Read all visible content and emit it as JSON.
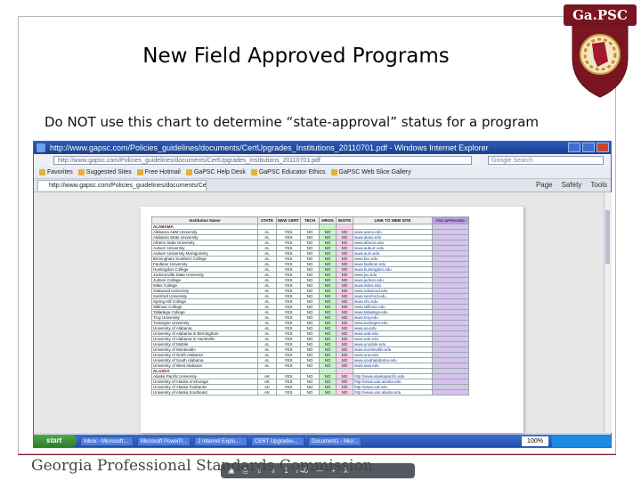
{
  "slide": {
    "title": "New Field Approved Programs",
    "subtitle": "Do NOT use this chart to determine “state-approval” status for a program",
    "footer": "Georgia Professional Standards Commission",
    "logo": {
      "banner": "Ga.PSC",
      "icon": "gapsc-shield-seal-icon"
    }
  },
  "screenshot": {
    "window_title": "http://www.gapsc.com/Policies_guidelines/documents/CertUpgrades_Institutions_20110701.pdf - Windows Internet Explorer",
    "address": "http://www.gapsc.com/Policies_guidelines/documents/CertUpgrades_Institutions_20110701.pdf",
    "search_placeholder": "Google Search",
    "favorites": [
      {
        "label": "Favorites"
      },
      {
        "label": "Suggested Sites"
      },
      {
        "label": "Free Hotmail"
      },
      {
        "label": "GaPSC Help Desk"
      },
      {
        "label": "GaPSC Educator Ethics"
      },
      {
        "label": "GaPSC Web Slice Gallery"
      }
    ],
    "tab_label": "http://www.gapsc.com/Policies_guidelines/documents/Cer...",
    "tab_tools": [
      "Page",
      "Safety",
      "Tools"
    ],
    "table": {
      "headers": [
        "Institution Name",
        "STATE",
        "NEW CERT",
        "TECH",
        "HRGN",
        "INSITE",
        "LINK TO WEB SITE",
        "PSC APPROVED"
      ],
      "rows": [
        {
          "name": "ALABAMA",
          "state_header": true
        },
        {
          "name": "Alabama A&M University",
          "st": "AL",
          "a": "YES",
          "b": "NO",
          "c": "NO",
          "d": "NO",
          "link": "www.aamu.edu"
        },
        {
          "name": "Alabama State University",
          "st": "AL",
          "a": "YES",
          "b": "NO",
          "c": "NO",
          "d": "NO",
          "link": "www.alasu.edu"
        },
        {
          "name": "Athens State University",
          "st": "AL",
          "a": "YES",
          "b": "NO",
          "c": "NO",
          "d": "NO",
          "link": "www.athens.edu"
        },
        {
          "name": "Auburn University",
          "st": "AL",
          "a": "YES",
          "b": "NO",
          "c": "NO",
          "d": "NO",
          "link": "www.auburn.edu"
        },
        {
          "name": "Auburn University Montgomery",
          "st": "AL",
          "a": "YES",
          "b": "NO",
          "c": "NO",
          "d": "NO",
          "link": "www.aum.edu"
        },
        {
          "name": "Birmingham Southern College",
          "st": "AL",
          "a": "YES",
          "b": "NO",
          "c": "NO",
          "d": "NO",
          "link": "www.bsc.edu"
        },
        {
          "name": "Faulkner University",
          "st": "AL",
          "a": "YES",
          "b": "NO",
          "c": "NO",
          "d": "NO",
          "link": "www.faulkner.edu"
        },
        {
          "name": "Huntingdon College",
          "st": "AL",
          "a": "YES",
          "b": "NO",
          "c": "NO",
          "d": "NO",
          "link": "www.huntingdon.edu"
        },
        {
          "name": "Jacksonville State University",
          "st": "AL",
          "a": "YES",
          "b": "NO",
          "c": "NO",
          "d": "NO",
          "link": "www.jsu.edu"
        },
        {
          "name": "Judson College",
          "st": "AL",
          "a": "YES",
          "b": "NO",
          "c": "NO",
          "d": "NO",
          "link": "www.judson.edu"
        },
        {
          "name": "Miles College",
          "st": "AL",
          "a": "YES",
          "b": "NO",
          "c": "NO",
          "d": "NO",
          "link": "www.miles.edu"
        },
        {
          "name": "Oakwood University",
          "st": "AL",
          "a": "YES",
          "b": "NO",
          "c": "NO",
          "d": "NO",
          "link": "www.oakwood.edu"
        },
        {
          "name": "Samford University",
          "st": "AL",
          "a": "YES",
          "b": "NO",
          "c": "NO",
          "d": "NO",
          "link": "www.samford.edu"
        },
        {
          "name": "Spring Hill College",
          "st": "AL",
          "a": "YES",
          "b": "NO",
          "c": "NO",
          "d": "NO",
          "link": "www.shc.edu"
        },
        {
          "name": "Stillman College",
          "st": "AL",
          "a": "YES",
          "b": "NO",
          "c": "NO",
          "d": "NO",
          "link": "www.stillman.edu"
        },
        {
          "name": "Talladega College",
          "st": "AL",
          "a": "YES",
          "b": "NO",
          "c": "NO",
          "d": "NO",
          "link": "www.talladega.edu"
        },
        {
          "name": "Troy University",
          "st": "AL",
          "a": "YES",
          "b": "NO",
          "c": "NO",
          "d": "NO",
          "link": "www.troy.edu"
        },
        {
          "name": "Tuskegee University",
          "st": "AL",
          "a": "YES",
          "b": "NO",
          "c": "NO",
          "d": "NO",
          "link": "www.tuskegee.edu"
        },
        {
          "name": "University of Alabama",
          "st": "AL",
          "a": "YES",
          "b": "NO",
          "c": "NO",
          "d": "NO",
          "link": "www.ua.edu"
        },
        {
          "name": "University of Alabama in Birmingham",
          "st": "AL",
          "a": "YES",
          "b": "NO",
          "c": "NO",
          "d": "NO",
          "link": "www.uab.edu"
        },
        {
          "name": "University of Alabama in Huntsville",
          "st": "AL",
          "a": "YES",
          "b": "NO",
          "c": "NO",
          "d": "NO",
          "link": "www.uah.edu"
        },
        {
          "name": "University of Mobile",
          "st": "AL",
          "a": "YES",
          "b": "NO",
          "c": "NO",
          "d": "NO",
          "link": "www.umobile.edu"
        },
        {
          "name": "University of Montevallo",
          "st": "AL",
          "a": "YES",
          "b": "NO",
          "c": "NO",
          "d": "NO",
          "link": "www.montevallo.edu"
        },
        {
          "name": "University of North Alabama",
          "st": "AL",
          "a": "YES",
          "b": "NO",
          "c": "NO",
          "d": "NO",
          "link": "www.una.edu"
        },
        {
          "name": "University of South Alabama",
          "st": "AL",
          "a": "YES",
          "b": "NO",
          "c": "NO",
          "d": "NO",
          "link": "www.southalabama.edu"
        },
        {
          "name": "University of West Alabama",
          "st": "AL",
          "a": "YES",
          "b": "NO",
          "c": "NO",
          "d": "NO",
          "link": "www.uwa.edu"
        },
        {
          "name": "ALASKA",
          "state_header": true
        },
        {
          "name": "Alaska Pacific University",
          "st": "AK",
          "a": "YES",
          "b": "NO",
          "c": "NO",
          "d": "NO",
          "link": "http://www.alaskapacific.edu"
        },
        {
          "name": "University of Alaska Anchorage",
          "st": "AK",
          "a": "YES",
          "b": "NO",
          "c": "NO",
          "d": "NO",
          "link": "http://www.uaa.alaska.edu"
        },
        {
          "name": "University of Alaska Fairbanks",
          "st": "AK",
          "a": "YES",
          "b": "NO",
          "c": "NO",
          "d": "NO",
          "link": "http://www.uaf.edu"
        },
        {
          "name": "University of Alaska Southeast",
          "st": "AK",
          "a": "YES",
          "b": "NO",
          "c": "NO",
          "d": "NO",
          "link": "http://www.uas.alaska.edu"
        }
      ]
    },
    "pdf_toolbar": {
      "page_current": "1",
      "page_total": "/ 40"
    },
    "taskbar": {
      "start_label": "start",
      "items": [
        "Inbox - Microsoft...",
        "Microsoft PowerP...",
        "2 Internet Explo...",
        "CERT Upgrades...",
        "Document1 - Micr..."
      ],
      "zoom": "100%"
    }
  }
}
